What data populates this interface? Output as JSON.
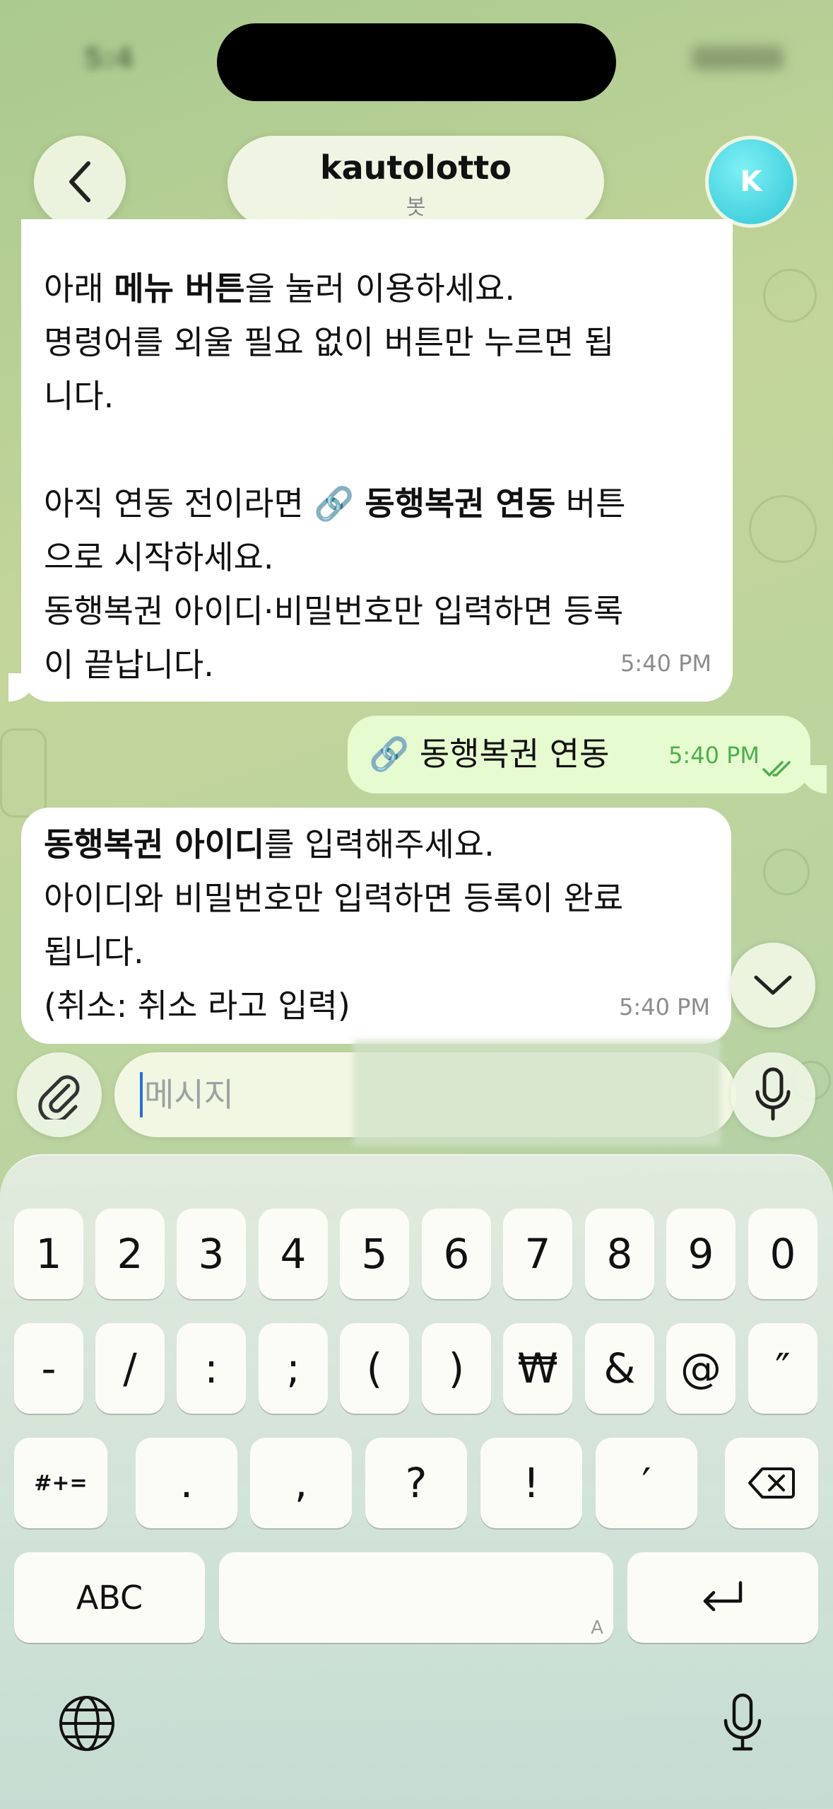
{
  "status_bar": {
    "time": "5:4"
  },
  "header": {
    "title": "kautolotto",
    "subtitle": "봇",
    "avatar_letter": "K",
    "back_icon": "chevron-left-icon"
  },
  "messages": [
    {
      "direction": "incoming",
      "lines": [
        {
          "parts": [
            {
              "text": "아래 ",
              "bold": false
            },
            {
              "text": "메뉴 버튼",
              "bold": true
            },
            {
              "text": "을 눌러 이용하세요.",
              "bold": false
            }
          ]
        },
        {
          "parts": [
            {
              "text": "명령어를 외울 필요 없이 버튼만 누르면 됩",
              "bold": false
            }
          ]
        },
        {
          "parts": [
            {
              "text": "니다.",
              "bold": false
            }
          ]
        },
        {
          "parts": [
            {
              "text": "아직 연동 전이라면 🔗 ",
              "bold": false
            },
            {
              "text": "동행복권 연동",
              "bold": true
            },
            {
              "text": " 버튼",
              "bold": false
            }
          ]
        },
        {
          "parts": [
            {
              "text": "으로 시작하세요.",
              "bold": false
            }
          ]
        },
        {
          "parts": [
            {
              "text": "동행복권 아이디·비밀번호만 입력하면 등록",
              "bold": false
            }
          ]
        },
        {
          "parts": [
            {
              "text": "이 끝납니다.",
              "bold": false
            }
          ]
        }
      ],
      "time": "5:40 PM"
    },
    {
      "direction": "outgoing",
      "text": "🔗 동행복권 연동",
      "time": "5:40 PM",
      "status_icon": "double-check-icon"
    },
    {
      "direction": "incoming",
      "lines": [
        {
          "parts": [
            {
              "text": "동행복권 아이디",
              "bold": true
            },
            {
              "text": "를 입력해주세요.",
              "bold": false
            }
          ]
        },
        {
          "parts": [
            {
              "text": "아이디와 비밀번호만 입력하면 등록이 완료",
              "bold": false
            }
          ]
        },
        {
          "parts": [
            {
              "text": "됩니다.",
              "bold": false
            }
          ]
        },
        {
          "parts": [
            {
              "text": "(취소: 취소 라고 입력)",
              "bold": false
            }
          ]
        }
      ],
      "time": "5:40 PM"
    }
  ],
  "composer": {
    "placeholder": "메시지",
    "attach_icon": "paperclip-icon",
    "mic_icon": "microphone-icon",
    "scroll_icon": "chevron-down-icon"
  },
  "keyboard": {
    "row1": [
      "1",
      "2",
      "3",
      "4",
      "5",
      "6",
      "7",
      "8",
      "9",
      "0"
    ],
    "row2": [
      "-",
      "/",
      ":",
      ";",
      "(",
      ")",
      "₩",
      "&",
      "@",
      "″"
    ],
    "row3": [
      "#+=",
      ".",
      ",",
      "?",
      "!",
      "′"
    ],
    "abc_label": "ABC",
    "space_corner": "A",
    "delete_icon": "backspace-icon",
    "return_icon": "return-icon",
    "globe_icon": "globe-icon",
    "dictation_icon": "microphone-icon"
  },
  "colors": {
    "incoming_bubble": "#ffffff",
    "outgoing_bubble": "#e6fbd0",
    "outgoing_time": "#4fae4e",
    "avatar": "#3fcfdc",
    "caret": "#2b6fd6"
  }
}
